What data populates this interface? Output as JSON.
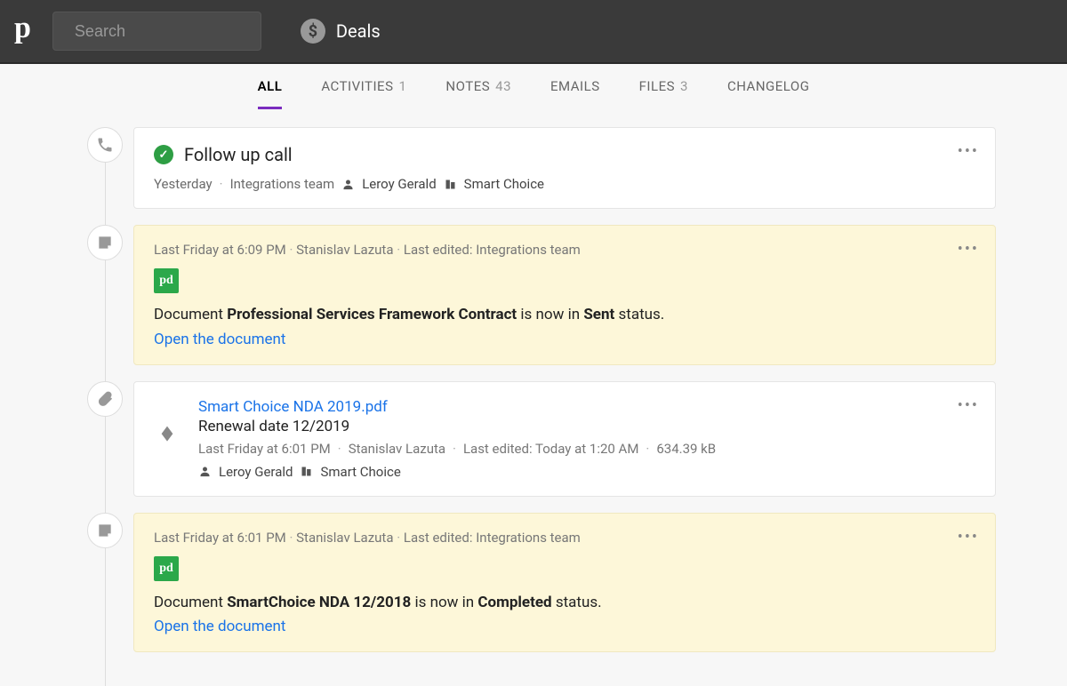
{
  "header": {
    "search_placeholder": "Search",
    "section_label": "Deals"
  },
  "tabs": [
    {
      "label": "ALL",
      "count": "",
      "active": true
    },
    {
      "label": "ACTIVITIES",
      "count": "1",
      "active": false
    },
    {
      "label": "NOTES",
      "count": "43",
      "active": false
    },
    {
      "label": "EMAILS",
      "count": "",
      "active": false
    },
    {
      "label": "FILES",
      "count": "3",
      "active": false
    },
    {
      "label": "CHANGELOG",
      "count": "",
      "active": false
    }
  ],
  "timeline": {
    "activity": {
      "title": "Follow up call",
      "time": "Yesterday",
      "team": "Integrations team",
      "person": "Leroy Gerald",
      "org": "Smart Choice"
    },
    "note1": {
      "time": "Last Friday at 6:09 PM",
      "author": "Stanislav Lazuta",
      "edited": "Last edited: Integrations team",
      "body_prefix": "Document ",
      "body_doc": "Professional Services Framework Contract",
      "body_mid": " is now in ",
      "body_status": "Sent",
      "body_suffix": " status.",
      "link": "Open the document"
    },
    "file": {
      "name": "Smart Choice NDA 2019.pdf",
      "subtitle": "Renewal date 12/2019",
      "time": "Last Friday at 6:01 PM",
      "author": "Stanislav Lazuta",
      "edited": "Last edited: Today at 1:20 AM",
      "size": "634.39 kB",
      "person": "Leroy Gerald",
      "org": "Smart Choice"
    },
    "note2": {
      "time": "Last Friday at 6:01 PM",
      "author": "Stanislav Lazuta",
      "edited": "Last edited: Integrations team",
      "body_prefix": "Document ",
      "body_doc": "SmartChoice NDA 12/2018",
      "body_mid": " is now in ",
      "body_status": "Completed",
      "body_suffix": " status.",
      "link": "Open the document"
    }
  }
}
